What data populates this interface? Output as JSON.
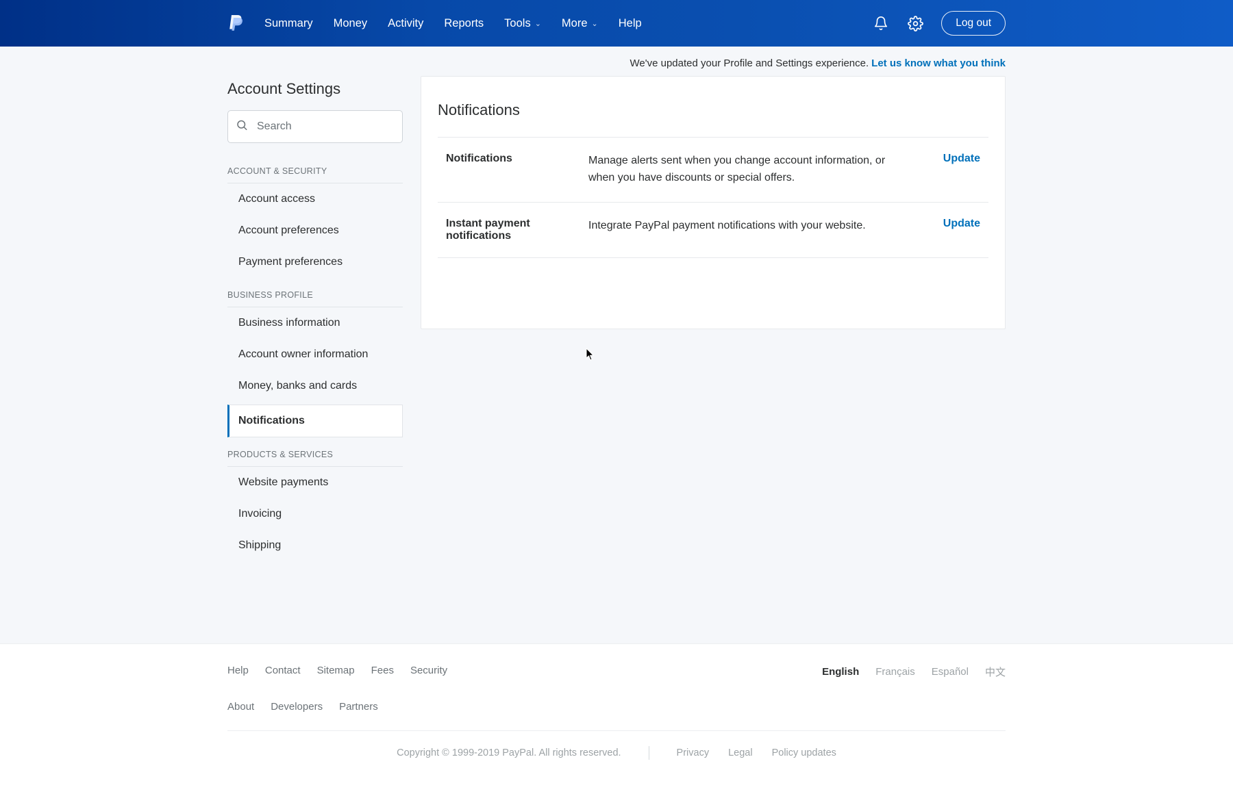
{
  "topnav": {
    "items": [
      "Summary",
      "Money",
      "Activity",
      "Reports",
      "Tools",
      "More",
      "Help"
    ],
    "logout": "Log out"
  },
  "banner": {
    "text": "We've updated your Profile and Settings experience.",
    "link": "Let us know what you think"
  },
  "sidebar": {
    "title": "Account Settings",
    "search_placeholder": "Search",
    "groups": [
      {
        "header": "ACCOUNT & SECURITY",
        "items": [
          "Account access",
          "Account preferences",
          "Payment preferences"
        ]
      },
      {
        "header": "BUSINESS PROFILE",
        "items": [
          "Business information",
          "Account owner information",
          "Money, banks and cards",
          "Notifications"
        ]
      },
      {
        "header": "PRODUCTS & SERVICES",
        "items": [
          "Website payments",
          "Invoicing",
          "Shipping"
        ]
      }
    ],
    "active": "Notifications"
  },
  "content": {
    "title": "Notifications",
    "rows": [
      {
        "label": "Notifications",
        "desc": "Manage alerts sent when you change account information, or when you have discounts or special offers.",
        "action": "Update"
      },
      {
        "label": "Instant payment notifications",
        "desc": "Integrate PayPal payment notifications with your website.",
        "action": "Update"
      }
    ]
  },
  "footer": {
    "links_row1": [
      "Help",
      "Contact",
      "Sitemap",
      "Fees",
      "Security"
    ],
    "links_row2": [
      "About",
      "Developers",
      "Partners"
    ],
    "languages": [
      "English",
      "Français",
      "Español",
      "中文"
    ],
    "active_language": "English",
    "copyright": "Copyright © 1999-2019 PayPal. All rights reserved.",
    "legal": [
      "Privacy",
      "Legal",
      "Policy updates"
    ]
  }
}
